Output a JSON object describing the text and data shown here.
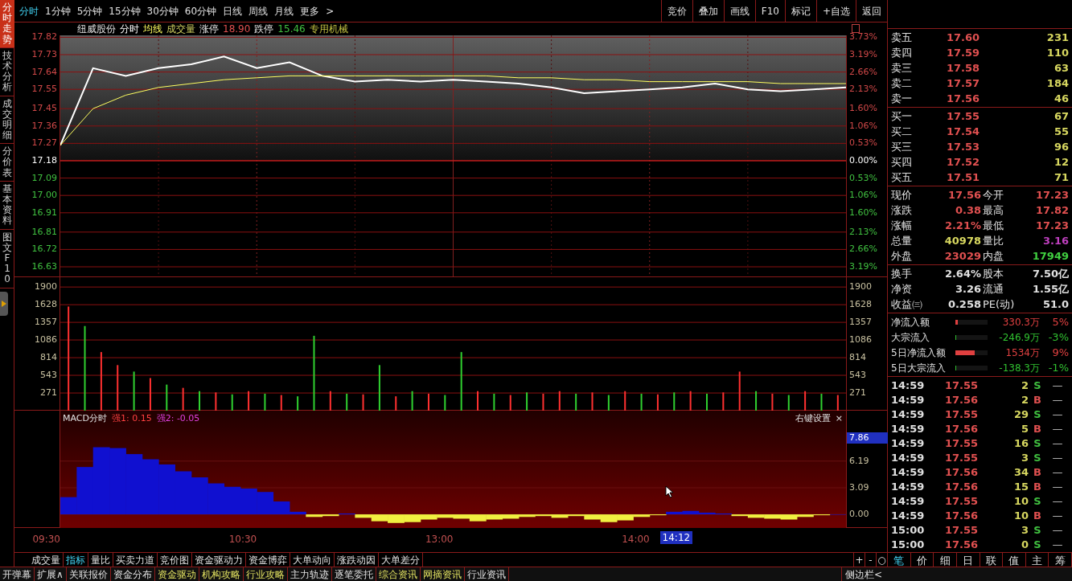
{
  "side_tabs": [
    {
      "label": "分时走势",
      "selected": true
    },
    {
      "label": "技术分析",
      "selected": false
    },
    {
      "label": "成交明细",
      "selected": false
    },
    {
      "label": "分价表",
      "selected": false
    },
    {
      "label": "基本资料",
      "selected": false
    },
    {
      "label": "图文F10",
      "selected": false
    }
  ],
  "period_tabs": [
    {
      "label": "分时",
      "selected": true
    },
    {
      "label": "1分钟",
      "selected": false
    },
    {
      "label": "5分钟",
      "selected": false
    },
    {
      "label": "15分钟",
      "selected": false
    },
    {
      "label": "30分钟",
      "selected": false
    },
    {
      "label": "60分钟",
      "selected": false
    },
    {
      "label": "日线",
      "selected": false
    },
    {
      "label": "周线",
      "selected": false
    },
    {
      "label": "月线",
      "selected": false
    },
    {
      "label": "更多",
      "selected": false
    },
    {
      "label": ">",
      "selected": false
    }
  ],
  "toolbar_buttons": [
    "竞价",
    "叠加",
    "画线",
    "F10",
    "标记",
    "+自选",
    "返回"
  ],
  "price_panel": {
    "stock_name": "纽威股份",
    "header": [
      {
        "text": "成交量",
        "kind": "indicator"
      },
      {
        "text": "涨停",
        "kind": "label"
      },
      {
        "text": "18.90",
        "color": "#e05050"
      },
      {
        "text": "跌停",
        "kind": "label"
      },
      {
        "text": "15.46",
        "color": "#40c040"
      },
      {
        "text": "专用机械",
        "color": "#c0c040"
      }
    ],
    "right_axis": [
      {
        "label": "3.73%",
        "color": "#d04848"
      },
      {
        "label": "3.19%",
        "color": "#d04848"
      },
      {
        "label": "2.66%",
        "color": "#d04848"
      },
      {
        "label": "2.13%",
        "color": "#d04848"
      },
      {
        "label": "1.60%",
        "color": "#d04848"
      },
      {
        "label": "1.06%",
        "color": "#d04848"
      },
      {
        "label": "0.53%",
        "color": "#d04848"
      },
      {
        "label": "0.00%",
        "color": "#ffffff"
      },
      {
        "label": "0.53%",
        "color": "#40c040"
      },
      {
        "label": "1.06%",
        "color": "#40c040"
      },
      {
        "label": "1.60%",
        "color": "#40c040"
      },
      {
        "label": "2.13%",
        "color": "#40c040"
      },
      {
        "label": "2.66%",
        "color": "#40c040"
      },
      {
        "label": "3.19%",
        "color": "#40c040"
      }
    ],
    "chart_data": {
      "type": "line",
      "grid": true,
      "categories": [
        null,
        null,
        null,
        null,
        null,
        null,
        null,
        null,
        null,
        null,
        null,
        null,
        null,
        null,
        null,
        null,
        null,
        null,
        null,
        null,
        null,
        null,
        null,
        null,
        null
      ],
      "series": [
        {
          "name": "分时",
          "color": "#ffffff",
          "values": [
            17.26,
            17.66,
            17.62,
            17.66,
            17.68,
            17.72,
            17.66,
            17.69,
            17.62,
            17.59,
            17.6,
            17.59,
            17.6,
            17.59,
            17.58,
            17.56,
            17.53,
            17.54,
            17.55,
            17.56,
            17.58,
            17.55,
            17.54,
            17.55,
            17.56
          ]
        },
        {
          "name": "均线",
          "color": "#ffff60",
          "values": [
            17.26,
            17.45,
            17.52,
            17.56,
            17.58,
            17.6,
            17.61,
            17.62,
            17.62,
            17.62,
            17.62,
            17.62,
            17.62,
            17.62,
            17.61,
            17.61,
            17.6,
            17.6,
            17.59,
            17.59,
            17.59,
            17.59,
            17.58,
            17.58,
            17.58
          ]
        }
      ],
      "ylim": [
        16.58,
        17.83
      ],
      "ref_lines": [
        {
          "axis": "y",
          "value": 17.18,
          "color": "#e02020"
        }
      ],
      "yticks": [
        {
          "value": 17.82,
          "label": "17.82"
        },
        {
          "value": 17.73,
          "label": "17.73"
        },
        {
          "value": 17.64,
          "label": "17.64"
        },
        {
          "value": 17.55,
          "label": "17.55"
        },
        {
          "value": 17.45,
          "label": "17.45"
        },
        {
          "value": 17.36,
          "label": "17.36"
        },
        {
          "value": 17.27,
          "label": "17.27"
        },
        {
          "value": 17.18,
          "label": "17.18"
        },
        {
          "value": 17.09,
          "label": "17.09"
        },
        {
          "value": 17.0,
          "label": "17.00"
        },
        {
          "value": 16.91,
          "label": "16.91"
        },
        {
          "value": 16.81,
          "label": "16.81"
        },
        {
          "value": 16.72,
          "label": "16.72"
        },
        {
          "value": 16.63,
          "label": "16.63"
        }
      ]
    }
  },
  "volume_panel": {
    "chart_data": {
      "type": "bar",
      "stacked": true,
      "grid": true,
      "categories": [
        null,
        null,
        null,
        null,
        null,
        null,
        null,
        null,
        null,
        null,
        null,
        null,
        null,
        null,
        null,
        null,
        null,
        null,
        null,
        null,
        null,
        null,
        null,
        null,
        null,
        null,
        null,
        null,
        null,
        null,
        null,
        null,
        null,
        null,
        null,
        null,
        null,
        null,
        null,
        null,
        null,
        null,
        null,
        null,
        null,
        null,
        null,
        null
      ],
      "series": [
        {
          "color": "#ff3030",
          "values": [
            1600,
            null,
            900,
            700,
            null,
            500,
            null,
            350,
            null,
            280,
            null,
            300,
            null,
            240,
            null,
            null,
            300,
            null,
            250,
            null,
            220,
            null,
            260,
            null,
            null,
            300,
            null,
            240,
            null,
            260,
            300,
            null,
            280,
            null,
            300,
            null,
            250,
            null,
            300,
            null,
            280,
            600,
            null,
            260,
            null,
            300,
            null,
            240
          ]
        },
        {
          "color": "#30d030",
          "values": [
            null,
            1300,
            null,
            null,
            600,
            null,
            400,
            null,
            300,
            null,
            250,
            null,
            260,
            null,
            220,
            1150,
            null,
            260,
            null,
            700,
            null,
            300,
            null,
            240,
            900,
            null,
            260,
            null,
            280,
            null,
            null,
            260,
            null,
            240,
            null,
            260,
            null,
            280,
            null,
            260,
            null,
            null,
            300,
            null,
            240,
            null,
            260,
            null
          ]
        }
      ],
      "ylim": [
        0,
        2050
      ],
      "yticks": [
        {
          "value": 271,
          "label": "271"
        },
        {
          "value": 543,
          "label": "543"
        },
        {
          "value": 814,
          "label": "814"
        },
        {
          "value": 1086,
          "label": "1086"
        },
        {
          "value": 1357,
          "label": "1357"
        },
        {
          "value": 1628,
          "label": "1628"
        },
        {
          "value": 1900,
          "label": "1900"
        }
      ]
    }
  },
  "macd_panel": {
    "title": "MACD分时",
    "strength": [
      {
        "text": "强1: 0.15",
        "color": "#ff4040"
      },
      {
        "text": "强2: -0.05",
        "color": "#e040e0"
      }
    ],
    "settings": "右键设置",
    "close": "×",
    "cursor_value": "7.86",
    "chart_data": {
      "type": "bar",
      "stacked": true,
      "grid": true,
      "categories": [
        null,
        null,
        null,
        null,
        null,
        null,
        null,
        null,
        null,
        null,
        null,
        null,
        null,
        null,
        null,
        null,
        null,
        null,
        null,
        null,
        null,
        null,
        null,
        null,
        null,
        null,
        null,
        null,
        null,
        null,
        null,
        null,
        null,
        null,
        null,
        null,
        null,
        null,
        null,
        null,
        null,
        null,
        null,
        null,
        null,
        null,
        null,
        null
      ],
      "series": [
        {
          "color": "#1010d0",
          "values": [
            2,
            5.5,
            7.8,
            7.7,
            7.0,
            6.4,
            5.8,
            5.0,
            4.3,
            3.6,
            3.2,
            3.0,
            2.6,
            1.5,
            0.3,
            null,
            null,
            0.1,
            null,
            null,
            null,
            null,
            null,
            null,
            null,
            null,
            null,
            null,
            null,
            null,
            null,
            null,
            null,
            null,
            null,
            null,
            null,
            0.3,
            0.4,
            0.2,
            0.1,
            null,
            null,
            null,
            null,
            null,
            null,
            0.0
          ]
        },
        {
          "color": "#f0f040",
          "values": [
            null,
            null,
            null,
            null,
            null,
            null,
            null,
            null,
            null,
            null,
            null,
            null,
            null,
            null,
            null,
            -0.3,
            -0.2,
            null,
            -0.4,
            -0.8,
            -1.0,
            -0.9,
            -0.6,
            -0.4,
            -0.5,
            -0.8,
            -0.6,
            -0.5,
            -0.3,
            -0.2,
            -0.4,
            -0.2,
            -0.6,
            -0.9,
            -0.7,
            -0.3,
            -0.1,
            null,
            null,
            null,
            null,
            -0.2,
            -0.4,
            -0.5,
            -0.6,
            -0.3,
            -0.1,
            null
          ]
        }
      ],
      "ylim": [
        -1.58,
        12.05
      ],
      "yticks": [
        {
          "value": 0,
          "label": "0.00"
        },
        {
          "value": 3.09,
          "label": "3.09"
        },
        {
          "value": 6.19,
          "label": "6.19"
        }
      ]
    }
  },
  "time_axis": {
    "ticks": [
      "09:30",
      "10:30",
      "13:00",
      "14:00"
    ],
    "cursor": "14:12"
  },
  "indicator_tabs": [
    {
      "label": "成交量",
      "selected": false
    },
    {
      "label": "指标",
      "selected": true
    },
    {
      "label": "量比",
      "selected": false
    },
    {
      "label": "买卖力道",
      "selected": false
    },
    {
      "label": "竞价图",
      "selected": false
    },
    {
      "label": "资金驱动力",
      "selected": false
    },
    {
      "label": "资金博弈",
      "selected": false
    },
    {
      "label": "大单动向",
      "selected": false
    },
    {
      "label": "涨跌动因",
      "selected": false
    },
    {
      "label": "大单差分",
      "selected": false
    }
  ],
  "zoom_buttons": [
    "+",
    "-",
    "○"
  ],
  "bottom_tabs": [
    {
      "label": "开弹幕",
      "highlight": false
    },
    {
      "label": "扩展∧",
      "highlight": false
    },
    {
      "label": "关联报价",
      "highlight": false
    },
    {
      "label": "资金分布",
      "highlight": false
    },
    {
      "label": "资金驱动",
      "highlight": true
    },
    {
      "label": "机构攻略",
      "highlight": true
    },
    {
      "label": "行业攻略",
      "highlight": true
    },
    {
      "label": "主力轨迹",
      "highlight": false
    },
    {
      "label": "逐笔委托",
      "highlight": false
    },
    {
      "label": "综合资讯",
      "highlight": true
    },
    {
      "label": "网摘资讯",
      "highlight": true
    },
    {
      "label": "行业资讯",
      "highlight": false
    }
  ],
  "sidebar_toggle": "侧边栏<",
  "order_book": {
    "sells": [
      {
        "label": "卖五",
        "price": "17.60",
        "volume": "231"
      },
      {
        "label": "卖四",
        "price": "17.59",
        "volume": "110"
      },
      {
        "label": "卖三",
        "price": "17.58",
        "volume": "63"
      },
      {
        "label": "卖二",
        "price": "17.57",
        "volume": "184"
      },
      {
        "label": "卖一",
        "price": "17.56",
        "volume": "46"
      }
    ],
    "buys": [
      {
        "label": "买一",
        "price": "17.55",
        "volume": "67"
      },
      {
        "label": "买二",
        "price": "17.54",
        "volume": "55"
      },
      {
        "label": "买三",
        "price": "17.53",
        "volume": "96"
      },
      {
        "label": "买四",
        "price": "17.52",
        "volume": "12"
      },
      {
        "label": "买五",
        "price": "17.51",
        "volume": "71"
      }
    ]
  },
  "quote": [
    [
      {
        "label": "现价",
        "value": "17.56",
        "color": "#e05050"
      },
      {
        "label": "今开",
        "value": "17.23",
        "color": "#e05050"
      }
    ],
    [
      {
        "label": "涨跌",
        "value": "0.38",
        "color": "#e05050"
      },
      {
        "label": "最高",
        "value": "17.82",
        "color": "#e05050"
      }
    ],
    [
      {
        "label": "涨幅",
        "value": "2.21%",
        "color": "#e05050"
      },
      {
        "label": "最低",
        "value": "17.23",
        "color": "#e05050"
      }
    ],
    [
      {
        "label": "总量",
        "value": "40978",
        "color": "#d8d860"
      },
      {
        "label": "量比",
        "value": "3.16",
        "color": "#c040c0"
      }
    ],
    [
      {
        "label": "外盘",
        "value": "23029",
        "color": "#e05050"
      },
      {
        "label": "内盘",
        "value": "17949",
        "color": "#40d040"
      }
    ]
  ],
  "fundamentals": [
    [
      {
        "label": "换手",
        "value": "2.64%"
      },
      {
        "label": "股本",
        "value": "7.50亿"
      }
    ],
    [
      {
        "label": "净资",
        "value": "3.26"
      },
      {
        "label": "流通",
        "value": "1.55亿"
      }
    ],
    [
      {
        "label": "收益㈢",
        "value": "0.258"
      },
      {
        "label": "PE(动)",
        "value": "51.0"
      }
    ]
  ],
  "fund_flows": [
    {
      "label": "净流入额",
      "value": "330.3万",
      "pct": "5%",
      "level": 0.08,
      "color": "#e04040"
    },
    {
      "label": "大宗流入",
      "value": "-246.9万",
      "pct": "-3%",
      "level": 0.03,
      "color": "#30c030"
    },
    {
      "label": "5日净流入额",
      "value": "1534万",
      "pct": "9%",
      "level": 0.6,
      "color": "#e04040"
    },
    {
      "label": "5日大宗流入",
      "value": "-138.3万",
      "pct": "-1%",
      "level": 0.03,
      "color": "#30c030"
    }
  ],
  "trades": [
    {
      "time": "14:59",
      "price": "17.55",
      "volume": "2",
      "side": "S",
      "kind": "sell",
      "flag": "—"
    },
    {
      "time": "14:59",
      "price": "17.56",
      "volume": "2",
      "side": "B",
      "kind": "buy",
      "flag": "—"
    },
    {
      "time": "14:59",
      "price": "17.55",
      "volume": "29",
      "side": "S",
      "kind": "sell",
      "flag": "—"
    },
    {
      "time": "14:59",
      "price": "17.56",
      "volume": "5",
      "side": "B",
      "kind": "buy",
      "flag": "—"
    },
    {
      "time": "14:59",
      "price": "17.55",
      "volume": "16",
      "side": "S",
      "kind": "sell",
      "flag": "—"
    },
    {
      "time": "14:59",
      "price": "17.55",
      "volume": "3",
      "side": "S",
      "kind": "sell",
      "flag": "—"
    },
    {
      "time": "14:59",
      "price": "17.56",
      "volume": "34",
      "side": "B",
      "kind": "buy",
      "flag": "—"
    },
    {
      "time": "14:59",
      "price": "17.56",
      "volume": "15",
      "side": "B",
      "kind": "buy",
      "flag": "—"
    },
    {
      "time": "14:59",
      "price": "17.55",
      "volume": "10",
      "side": "S",
      "kind": "sell",
      "flag": "—"
    },
    {
      "time": "14:59",
      "price": "17.56",
      "volume": "10",
      "side": "B",
      "kind": "buy",
      "flag": "—"
    },
    {
      "time": "15:00",
      "price": "17.55",
      "volume": "3",
      "side": "S",
      "kind": "sell",
      "flag": "—"
    },
    {
      "time": "15:00",
      "price": "17.56",
      "volume": "0",
      "side": "S",
      "kind": "sell",
      "flag": "—"
    }
  ],
  "detail_tabs": [
    {
      "label": "笔",
      "selected": true
    },
    {
      "label": "价",
      "selected": false
    },
    {
      "label": "细",
      "selected": false
    },
    {
      "label": "日",
      "selected": false
    },
    {
      "label": "联",
      "selected": false
    },
    {
      "label": "值",
      "selected": false
    },
    {
      "label": "主",
      "selected": false
    },
    {
      "label": "筹",
      "selected": false
    }
  ]
}
